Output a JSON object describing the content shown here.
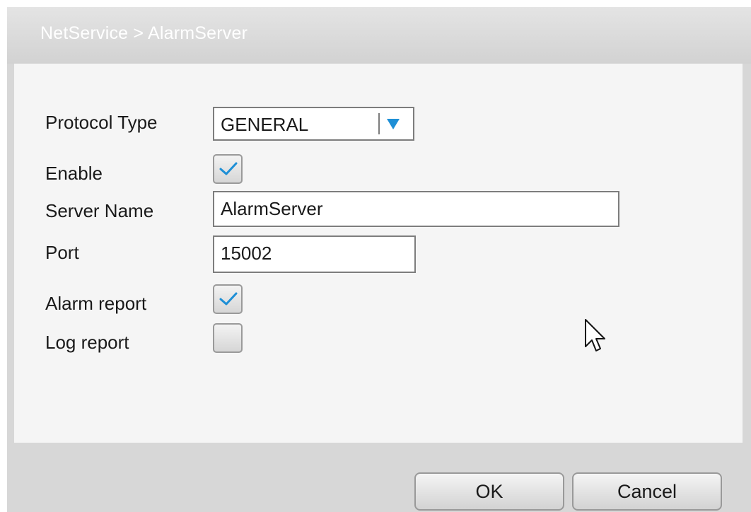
{
  "dialog": {
    "title": "NetService > AlarmServer"
  },
  "form": {
    "protocol_type": {
      "label": "Protocol Type",
      "value": "GENERAL"
    },
    "enable": {
      "label": "Enable",
      "checked": true
    },
    "server_name": {
      "label": "Server Name",
      "value": "AlarmServer"
    },
    "port": {
      "label": "Port",
      "value": "15002"
    },
    "alarm_report": {
      "label": "Alarm report",
      "checked": true
    },
    "log_report": {
      "label": "Log report",
      "checked": false
    }
  },
  "buttons": {
    "ok_label": "OK",
    "cancel_label": "Cancel"
  },
  "colors": {
    "title_text": "#ffffff",
    "accent": "#1e8fd6",
    "panel_background": "#f5f5f5",
    "dialog_background": "#d7d7d7"
  },
  "icons": {
    "dropdown": "triangle-down-icon",
    "check": "checkmark-icon",
    "cursor": "mouse-pointer-icon"
  }
}
